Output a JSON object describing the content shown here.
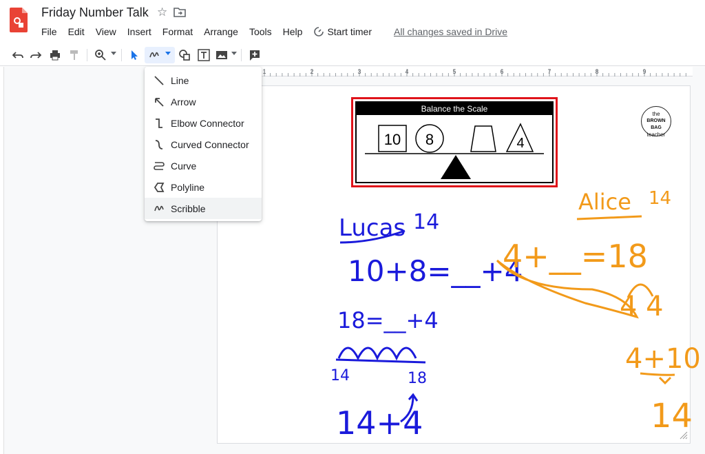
{
  "document": {
    "title": "Friday Number Talk",
    "saved_status": "All changes saved in Drive"
  },
  "menu": {
    "items": [
      "File",
      "Edit",
      "View",
      "Insert",
      "Format",
      "Arrange",
      "Tools",
      "Help"
    ],
    "timer_label": "Start timer"
  },
  "line_menu": {
    "items": [
      {
        "label": "Line",
        "icon": "line-icon"
      },
      {
        "label": "Arrow",
        "icon": "arrow-icon"
      },
      {
        "label": "Elbow Connector",
        "icon": "elbow-connector-icon"
      },
      {
        "label": "Curved Connector",
        "icon": "curved-connector-icon"
      },
      {
        "label": "Curve",
        "icon": "curve-icon"
      },
      {
        "label": "Polyline",
        "icon": "polyline-icon"
      },
      {
        "label": "Scribble",
        "icon": "scribble-icon"
      }
    ],
    "selected": "Scribble"
  },
  "ruler": {
    "numbers": [
      "1",
      "2",
      "3",
      "4",
      "5",
      "6",
      "7",
      "8",
      "9"
    ]
  },
  "card": {
    "title": "Balance the Scale",
    "square_value": "10",
    "circle_value": "8",
    "triangle_value": "4"
  },
  "logo": {
    "line1": "the",
    "line2": "BROWN BAG",
    "line3": "teacher"
  },
  "scribbles": {
    "lucas_name": "Lucas",
    "lucas_answer": "14",
    "lucas_eq1": "10+8=__+4",
    "lucas_eq2": "18=__+4",
    "lucas_left": "14",
    "lucas_right": "18",
    "lucas_eq3": "14+4",
    "alice_name": "Alice",
    "alice_answer": "14",
    "alice_eq1": "4+__=18",
    "alice_eq2": "4 4",
    "alice_eq3": "4+10",
    "alice_eq4": "14"
  },
  "colors": {
    "blue_ink": "#1a1adb",
    "orange_ink": "#f29a1a",
    "card_border": "#e0131a",
    "accent": "#1a73e8"
  }
}
